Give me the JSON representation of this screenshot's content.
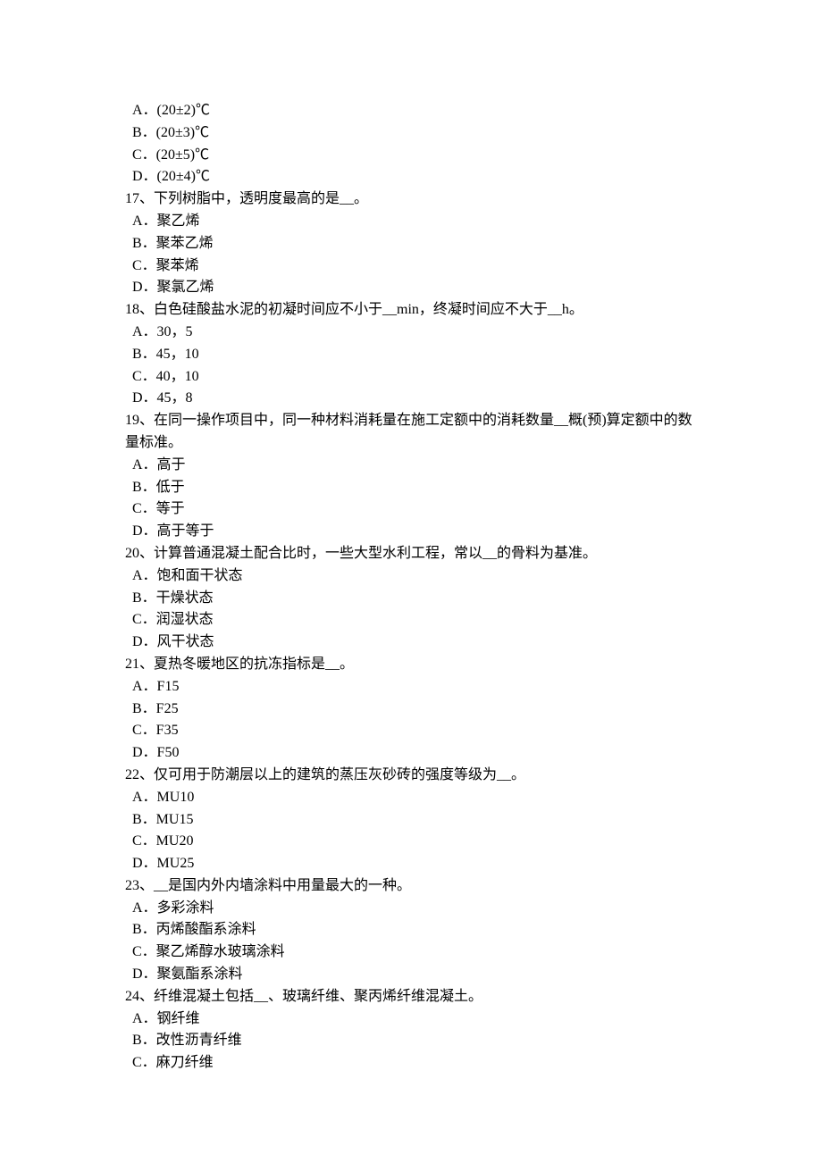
{
  "lines": [
    {
      "cls": "option",
      "text": "A．(20±2)℃"
    },
    {
      "cls": "option",
      "text": "B．(20±3)℃"
    },
    {
      "cls": "option",
      "text": "C．(20±5)℃"
    },
    {
      "cls": "option",
      "text": "D．(20±4)℃"
    },
    {
      "cls": "question",
      "text": "17、下列树脂中，透明度最高的是__。"
    },
    {
      "cls": "option",
      "text": "A．聚乙烯"
    },
    {
      "cls": "option",
      "text": "B．聚苯乙烯"
    },
    {
      "cls": "option",
      "text": "C．聚苯烯"
    },
    {
      "cls": "option",
      "text": "D．聚氯乙烯"
    },
    {
      "cls": "question",
      "text": "18、白色硅酸盐水泥的初凝时间应不小于__min，终凝时间应不大于__h。"
    },
    {
      "cls": "option",
      "text": "A．30，5"
    },
    {
      "cls": "option",
      "text": "B．45，10"
    },
    {
      "cls": "option",
      "text": "C．40，10"
    },
    {
      "cls": "option",
      "text": "D．45，8"
    },
    {
      "cls": "question",
      "text": "19、在同一操作项目中，同一种材料消耗量在施工定额中的消耗数量__概(预)算定额中的数量标准。"
    },
    {
      "cls": "option",
      "text": "A．高于"
    },
    {
      "cls": "option",
      "text": "B．低于"
    },
    {
      "cls": "option",
      "text": "C．等于"
    },
    {
      "cls": "option",
      "text": "D．高于等于"
    },
    {
      "cls": "question",
      "text": "20、计算普通混凝土配合比时，一些大型水利工程，常以__的骨料为基准。"
    },
    {
      "cls": "option",
      "text": "A．饱和面干状态"
    },
    {
      "cls": "option",
      "text": "B．干燥状态"
    },
    {
      "cls": "option",
      "text": "C．润湿状态"
    },
    {
      "cls": "option",
      "text": "D．风干状态"
    },
    {
      "cls": "question",
      "text": "21、夏热冬暖地区的抗冻指标是__。"
    },
    {
      "cls": "option",
      "text": "A．F15"
    },
    {
      "cls": "option",
      "text": "B．F25"
    },
    {
      "cls": "option",
      "text": "C．F35"
    },
    {
      "cls": "option",
      "text": "D．F50"
    },
    {
      "cls": "question",
      "text": "22、仅可用于防潮层以上的建筑的蒸压灰砂砖的强度等级为__。"
    },
    {
      "cls": "option",
      "text": "A．MU10"
    },
    {
      "cls": "option",
      "text": "B．MU15"
    },
    {
      "cls": "option",
      "text": "C．MU20"
    },
    {
      "cls": "option",
      "text": "D．MU25"
    },
    {
      "cls": "question",
      "text": "23、__是国内外内墙涂料中用量最大的一种。"
    },
    {
      "cls": "option",
      "text": "A．多彩涂料"
    },
    {
      "cls": "option",
      "text": "B．丙烯酸酯系涂料"
    },
    {
      "cls": "option",
      "text": "C．聚乙烯醇水玻璃涂料"
    },
    {
      "cls": "option",
      "text": "D．聚氨酯系涂料"
    },
    {
      "cls": "question",
      "text": "24、纤维混凝土包括__、玻璃纤维、聚丙烯纤维混凝土。"
    },
    {
      "cls": "option",
      "text": "A．钢纤维"
    },
    {
      "cls": "option",
      "text": "B．改性沥青纤维"
    },
    {
      "cls": "option",
      "text": "C．麻刀纤维"
    }
  ]
}
